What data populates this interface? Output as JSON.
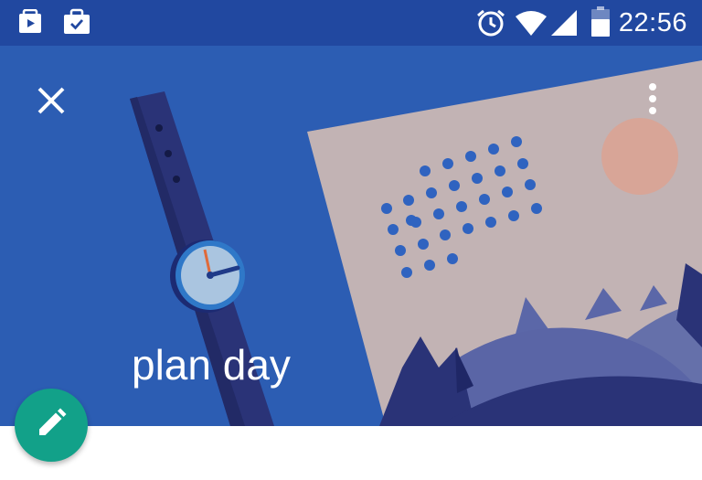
{
  "status_bar": {
    "time": "22:56",
    "icons": [
      "play-store-notification-icon",
      "briefcase-check-icon",
      "alarm-icon",
      "wifi-icon",
      "cellular-signal-icon",
      "battery-icon"
    ]
  },
  "header": {
    "title": "plan day",
    "close_icon": "close-icon",
    "more_icon": "more-vertical-icon"
  },
  "fab": {
    "icon": "pencil-icon"
  },
  "colors": {
    "status_bar": "#2148a0",
    "header": "#2c5db3",
    "fab": "#12a189",
    "card": "#c2b3b4",
    "sun": "#d8a597",
    "watch_band": "#2a3377",
    "watch_face": "#aac5e0"
  }
}
